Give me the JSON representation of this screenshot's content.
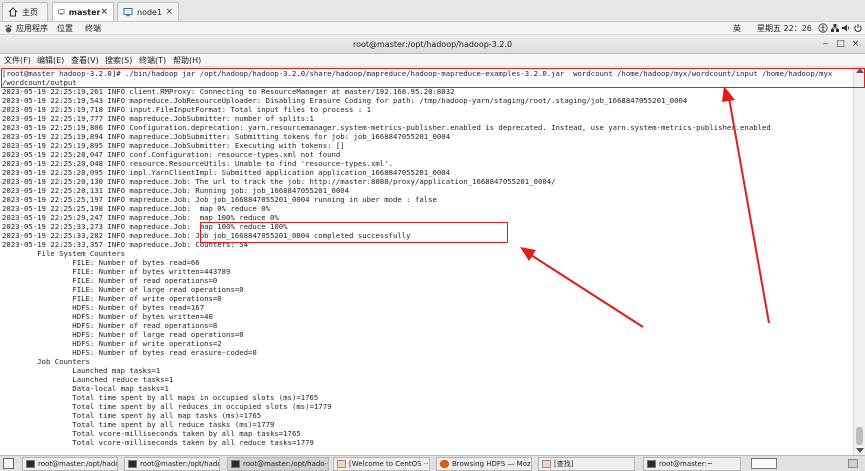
{
  "vm_tabs": [
    {
      "label": "主页",
      "icon": "home-icon"
    },
    {
      "label": "master",
      "icon": "vm-icon",
      "close": "×"
    },
    {
      "label": "node1",
      "icon": "vm-icon",
      "close": "×"
    }
  ],
  "gnome": {
    "apps": "应用程序",
    "places": "位置",
    "terminal": "终端",
    "ime": "英",
    "clock": "星期五 22：26"
  },
  "terminal_window": {
    "title": "root@master:/opt/hadoop/hadoop-3.2.0",
    "menu": [
      "文件(F)",
      "编辑(E)",
      "查看(V)",
      "搜索(S)",
      "终端(T)",
      "帮助(H)"
    ]
  },
  "terminal_lines": [
    "[root@master hadoop-3.2.0]# ./bin/hadoop jar /opt/hadoop/hadoop-3.2.0/share/hadoop/mapreduce/hadoop-mapreduce-examples-3.2.0.jar  wordcount /home/hadoop/myx/wordcount/input /home/hadoop/myx",
    "/wordcount/output",
    "2023-05-19 22:25:19,261 INFO client.RMProxy: Connecting to ResourceManager at master/192.168.95.20:8032",
    "2023-05-19 22:25:19,543 INFO mapreduce.JobResourceUploader: Disabling Erasure Coding for path: /tmp/hadoop-yarn/staging/root/.staging/job_1668847055201_0004",
    "2023-05-19 22:25:19,718 INFO input.FileInputFormat: Total input files to process : 1",
    "2023-05-19 22:25:19,777 INFO mapreduce.JobSubmitter: number of splits:1",
    "2023-05-19 22:25:19,806 INFO Configuration.deprecation: yarn.resourcemanager.system-metrics-publisher.enabled is deprecated. Instead, use yarn.system-metrics-publisher.enabled",
    "2023-05-19 22:25:19,894 INFO mapreduce.JobSubmitter: Submitting tokens for job: job_1668847055201_0004",
    "2023-05-19 22:25:19,895 INFO mapreduce.JobSubmitter: Executing with tokens: []",
    "2023-05-19 22:25:20,047 INFO conf.Configuration: resource-types.xml not found",
    "2023-05-19 22:25:20,048 INFO resource.ResourceUtils: Unable to find 'resource-types.xml'.",
    "2023-05-19 22:25:20,095 INFO impl.YarnClientImpl: Submitted application application_1668847055201_0004",
    "2023-05-19 22:25:20,130 INFO mapreduce.Job: The url to track the job: http://master:8088/proxy/application_1668847055201_0004/",
    "2023-05-19 22:25:20,131 INFO mapreduce.Job: Running job: job_1668847055201_0004",
    "2023-05-19 22:25:25,197 INFO mapreduce.Job: Job job_1668847055201_0004 running in uber mode : false",
    "2023-05-19 22:25:25,198 INFO mapreduce.Job:  map 0% reduce 0%",
    "2023-05-19 22:25:29,247 INFO mapreduce.Job:  map 100% reduce 0%",
    "2023-05-19 22:25:33,273 INFO mapreduce.Job:  map 100% reduce 100%",
    "2023-05-19 22:25:33,282 INFO mapreduce.Job: Job job_1668847055201_0004 completed successfully",
    "2023-05-19 22:25:33,357 INFO mapreduce.Job: Counters: 54",
    "\tFile System Counters",
    "\t\tFILE: Number of bytes read=66",
    "\t\tFILE: Number of bytes written=443789",
    "\t\tFILE: Number of read operations=0",
    "\t\tFILE: Number of large read operations=0",
    "\t\tFILE: Number of write operations=0",
    "\t\tHDFS: Number of bytes read=167",
    "\t\tHDFS: Number of bytes written=40",
    "\t\tHDFS: Number of read operations=8",
    "\t\tHDFS: Number of large read operations=0",
    "\t\tHDFS: Number of write operations=2",
    "\t\tHDFS: Number of bytes read erasure-coded=0",
    "\tJob Counters",
    "\t\tLaunched map tasks=1",
    "\t\tLaunched reduce tasks=1",
    "\t\tData-local map tasks=1",
    "\t\tTotal time spent by all maps in occupied slots (ms)=1765",
    "\t\tTotal time spent by all reduces in occupied slots (ms)=1779",
    "\t\tTotal time spent by all map tasks (ms)=1765",
    "\t\tTotal time spent by all reduce tasks (ms)=1779",
    "\t\tTotal vcore-milliseconds taken by all map tasks=1765",
    "\t\tTotal vcore-milliseconds taken by all reduce tasks=1779"
  ],
  "taskbar": [
    {
      "label": "root@master:/opt/hado···",
      "icon": "terminal-icon"
    },
    {
      "label": "root@master:/opt/hado···",
      "icon": "terminal-icon"
    },
    {
      "label": "root@master:/opt/hado···",
      "icon": "terminal-icon"
    },
    {
      "label": "[Welcome to CentOS ··· ",
      "icon": "firefox-icon"
    },
    {
      "label": "Browsing HDFS — Mozil···",
      "icon": "firefox-icon"
    },
    {
      "label": "[查找]",
      "icon": "search-window-icon"
    },
    {
      "label": "root@master:~",
      "icon": "terminal-icon"
    }
  ],
  "colors": {
    "annotation": "#e21b1b"
  }
}
